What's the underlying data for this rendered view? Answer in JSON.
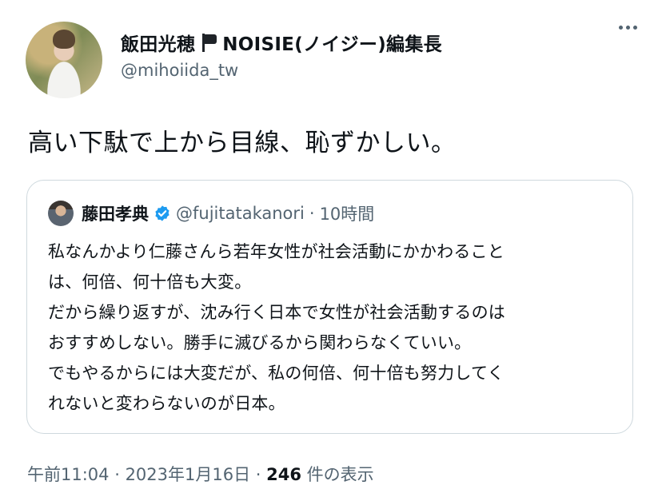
{
  "author": {
    "name": "飯田光穂",
    "suffix": "NOISIE(ノイジー)編集長",
    "handle": "@mihoiida_tw"
  },
  "tweet": {
    "text": "高い下駄で上から目線、恥ずかしい。"
  },
  "quote": {
    "name": "藤田孝典",
    "handle": "@fujitatakanori",
    "separator": "·",
    "time": "10時間",
    "lines": [
      "私なんかより仁藤さんら若年女性が社会活動にかかわること",
      "は、何倍、何十倍も大変。",
      "だから繰り返すが、沈み行く日本で女性が社会活動するのは",
      "おすすめしない。勝手に滅びるから関わらなくていい。",
      "でもやるからには大変だが、私の何倍、何十倍も努力してく",
      "れないと変わらないのが日本。"
    ]
  },
  "meta": {
    "time": "午前11:04",
    "sep1": " · ",
    "date": "2023年1月16日",
    "sep2": " · ",
    "views": "246",
    "views_label": " 件の表示"
  },
  "colors": {
    "verified": "#1d9bf0",
    "secondary": "#536471"
  },
  "icons": {
    "flag": "black-flag-icon",
    "more": "more-options-icon",
    "verified": "verified-badge-icon"
  }
}
